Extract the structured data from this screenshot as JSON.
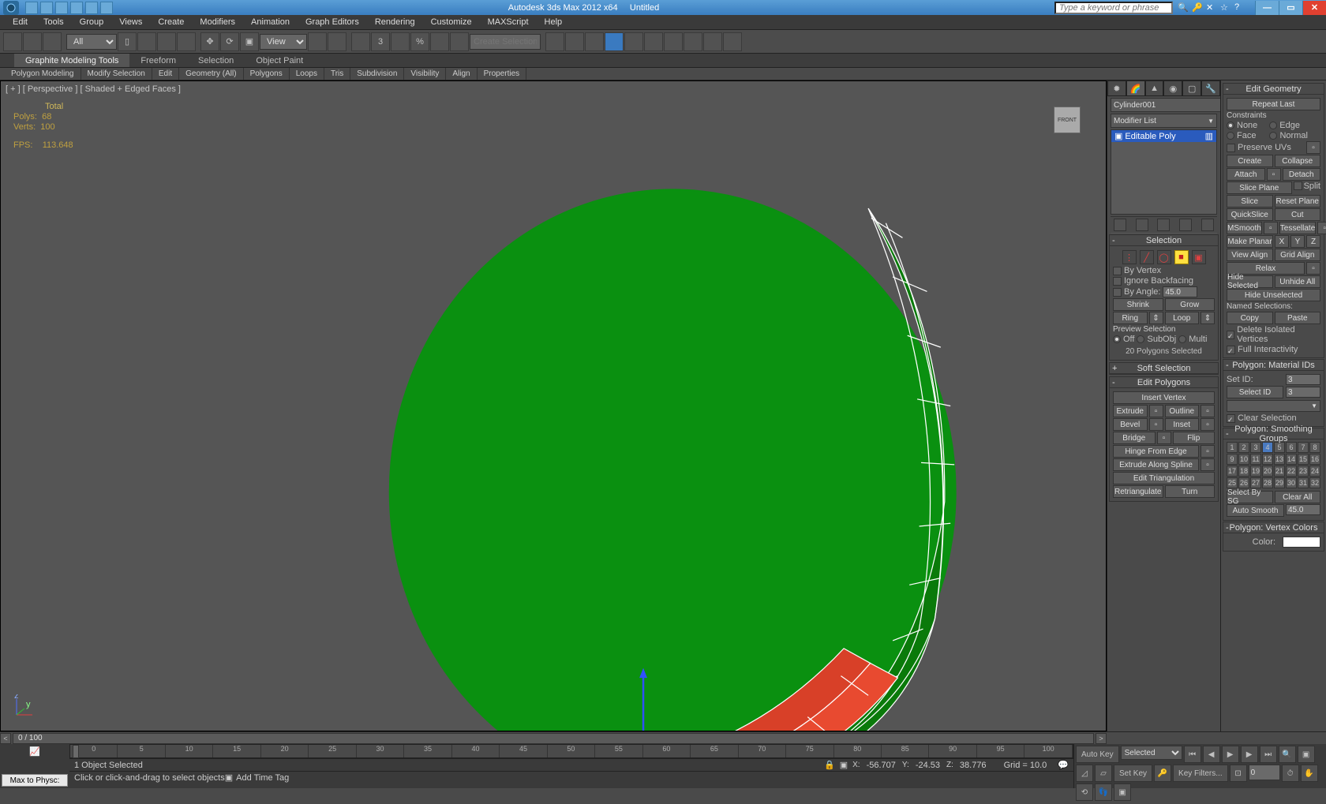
{
  "titlebar": {
    "app": "Autodesk 3ds Max 2012 x64",
    "doc": "Untitled",
    "search_placeholder": "Type a keyword or phrase"
  },
  "menu": [
    "Edit",
    "Tools",
    "Group",
    "Views",
    "Create",
    "Modifiers",
    "Animation",
    "Graph Editors",
    "Rendering",
    "Customize",
    "MAXScript",
    "Help"
  ],
  "toolbar": {
    "sel_filter": "All",
    "named_sel_placeholder": "Create Selection Se",
    "view": "View"
  },
  "ribbon_tabs": [
    "Graphite Modeling Tools",
    "Freeform",
    "Selection",
    "Object Paint"
  ],
  "ribbon_sub": [
    "Polygon Modeling",
    "Modify Selection",
    "Edit",
    "Geometry (All)",
    "Polygons",
    "Loops",
    "Tris",
    "Subdivision",
    "Visibility",
    "Align",
    "Properties"
  ],
  "viewport": {
    "label": "[ + ] [ Perspective ] [ Shaded + Edged Faces ]",
    "stats": {
      "h": "Total",
      "polys_l": "Polys:",
      "polys_v": "68",
      "verts_l": "Verts:",
      "verts_v": "100",
      "fps_l": "FPS:",
      "fps_v": "113.648"
    },
    "cube": "FRONT"
  },
  "cmd": {
    "obj_name": "Cylinder001",
    "modifier_list": "Modifier List",
    "stack_item": "Editable Poly"
  },
  "selection": {
    "title": "Selection",
    "by_vertex": "By Vertex",
    "ignore_backfacing": "Ignore Backfacing",
    "by_angle": "By Angle:",
    "angle": "45.0",
    "shrink": "Shrink",
    "grow": "Grow",
    "ring": "Ring",
    "loop": "Loop",
    "preview": "Preview Selection",
    "off": "Off",
    "subobj": "SubObj",
    "multi": "Multi",
    "sel_info": "20 Polygons Selected"
  },
  "soft_sel": {
    "title": "Soft Selection"
  },
  "edit_polys": {
    "title": "Edit Polygons",
    "insert_vertex": "Insert Vertex",
    "extrude": "Extrude",
    "outline": "Outline",
    "bevel": "Bevel",
    "inset": "Inset",
    "bridge": "Bridge",
    "flip": "Flip",
    "hinge": "Hinge From Edge",
    "extrude_spline": "Extrude Along Spline",
    "edit_tri": "Edit Triangulation",
    "retri": "Retriangulate",
    "turn": "Turn"
  },
  "edit_geom": {
    "title": "Edit Geometry",
    "repeat": "Repeat Last",
    "constraints": "Constraints",
    "none": "None",
    "edge": "Edge",
    "face": "Face",
    "normal": "Normal",
    "preserve_uv": "Preserve UVs",
    "create": "Create",
    "collapse": "Collapse",
    "attach": "Attach",
    "detach": "Detach",
    "slice_plane": "Slice Plane",
    "split": "Split",
    "slice": "Slice",
    "reset_plane": "Reset Plane",
    "quickslice": "QuickSlice",
    "cut": "Cut",
    "msmooth": "MSmooth",
    "tessellate": "Tessellate",
    "make_planar": "Make Planar",
    "x": "X",
    "y": "Y",
    "z": "Z",
    "view_align": "View Align",
    "grid_align": "Grid Align",
    "relax": "Relax",
    "hide_sel": "Hide Selected",
    "unhide_all": "Unhide All",
    "hide_unsel": "Hide Unselected",
    "named_sel": "Named Selections:",
    "copy": "Copy",
    "paste": "Paste",
    "del_iso": "Delete Isolated Vertices",
    "full_inter": "Full Interactivity"
  },
  "mat_ids": {
    "title": "Polygon: Material IDs",
    "set_id": "Set ID:",
    "set_v": "3",
    "sel_id": "Select ID",
    "sel_v": "3",
    "clear": "Clear Selection"
  },
  "smoothing": {
    "title": "Polygon: Smoothing Groups",
    "select_by_sg": "Select By SG",
    "clear_all": "Clear All",
    "auto": "Auto Smooth",
    "auto_v": "45.0",
    "selected": 4
  },
  "vertex_colors": {
    "title": "Polygon: Vertex Colors",
    "color": "Color:"
  },
  "track": {
    "cur": "0 / 100"
  },
  "timeline_ticks": [
    "0",
    "5",
    "10",
    "15",
    "20",
    "25",
    "30",
    "35",
    "40",
    "45",
    "50",
    "55",
    "60",
    "65",
    "70",
    "75",
    "80",
    "85",
    "90",
    "95",
    "100"
  ],
  "status": {
    "sel": "1 Object Selected",
    "x": "X:",
    "xv": "-56.707",
    "y": "Y:",
    "yv": "-24.53",
    "z": "Z:",
    "zv": "38.776",
    "grid": "Grid = 10.0",
    "autokey": "Auto Key",
    "setkey": "Set Key",
    "keyfilters": "Key Filters...",
    "frame_sel": "Selected",
    "max_physc": "Max to Physc:"
  },
  "prompt": {
    "text": "Click or click-and-drag to select objects",
    "addtag": "Add Time Tag"
  }
}
